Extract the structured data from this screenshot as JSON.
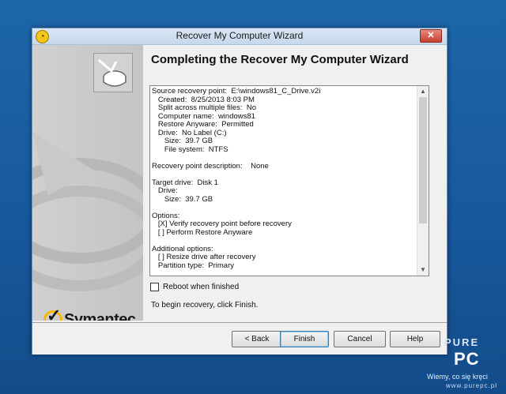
{
  "window": {
    "title": "Recover My Computer Wizard",
    "close_label": "✕"
  },
  "main": {
    "heading": "Completing the Recover My Computer Wizard",
    "summary_lines": [
      "Source recovery point:  E:\\windows81_C_Drive.v2i",
      "   Created:  8/25/2013 8:03 PM",
      "   Split across multiple files:  No",
      "   Computer name:  windows81",
      "   Restore Anyware:  Permitted",
      "   Drive:  No Label (C:)",
      "      Size:  39.7 GB",
      "      File system:  NTFS",
      "",
      "Recovery point description:    None",
      "",
      "Target drive:  Disk 1",
      "   Drive:",
      "      Size:  39.7 GB",
      "",
      "Options:",
      "   [X] Verify recovery point before recovery",
      "   [ ] Perform Restore Anyware",
      "",
      "Additional options:",
      "   [ ] Resize drive after recovery",
      "   Partition type:  Primary"
    ],
    "reboot_label": "Reboot when finished",
    "reboot_checked": false,
    "hint": "To begin recovery, click Finish."
  },
  "footer": {
    "back_label": "< Back",
    "finish_label": "Finish",
    "cancel_label": "Cancel",
    "help_label": "Help"
  },
  "branding": {
    "logo_text": "Symantec.",
    "logo_color": "#f7b900"
  },
  "watermark": {
    "pure": "PURE",
    "pc": "PC",
    "slogan": "Wiemy, co się kręci",
    "url": "www.purepc.pl"
  }
}
